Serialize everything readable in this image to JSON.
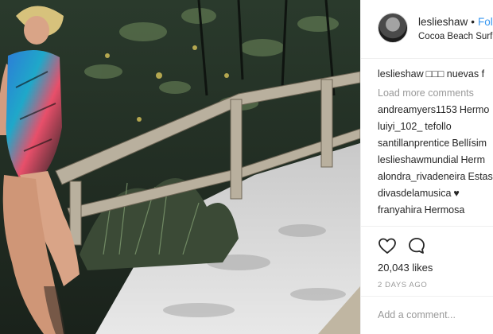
{
  "post": {
    "username": "leslieshaw",
    "separator": "•",
    "follow_label": "Follo",
    "location": "Cocoa Beach Surf C"
  },
  "comments": {
    "caption": {
      "user": "leslieshaw",
      "text": "□□□ nuevas f"
    },
    "load_more": "Load more comments",
    "items": [
      {
        "user": "andreamyers1153",
        "text": "Hermo"
      },
      {
        "user": "luiyi_102_",
        "text": "tefollo"
      },
      {
        "user": "santillanprentice",
        "text": "Bellísim"
      },
      {
        "user": "leslieshawmundial",
        "text": "Herm"
      },
      {
        "user": "alondra_rivadeneira",
        "text": "Estas"
      },
      {
        "user": "divasdelamusica",
        "text": "♥"
      },
      {
        "user": "franyahira",
        "text": "Hermosa"
      }
    ]
  },
  "actions": {
    "like_icon": "heart-icon",
    "comment_icon": "comment-bubble-icon",
    "likes": "20,043 likes",
    "timestamp": "2 DAYS AGO"
  },
  "add_comment": {
    "placeholder": "Add a comment..."
  },
  "colors": {
    "link": "#3897f0",
    "muted": "#999999",
    "text": "#262626",
    "border": "#efefef"
  }
}
